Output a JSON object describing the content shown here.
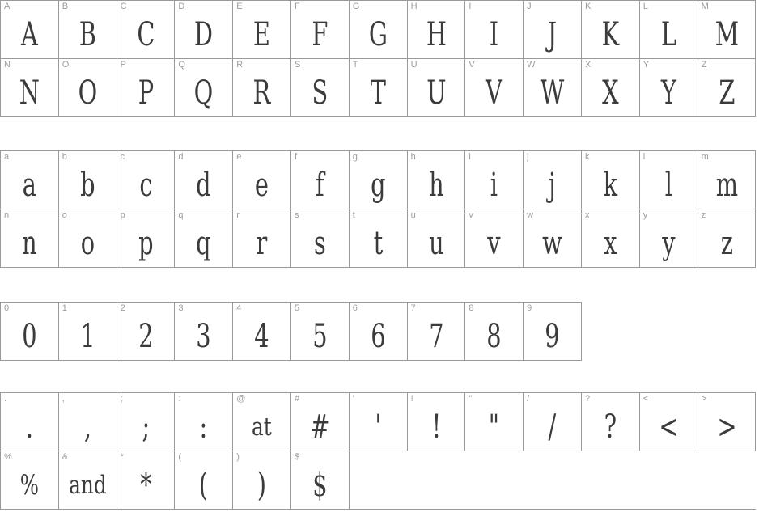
{
  "document": {
    "kind": "font-specimen-character-map",
    "background_color": "#ffffff",
    "grid_border_color": "#9a9a9a",
    "label_color": "#9c9c9c",
    "glyph_color": "#3b3b3b"
  },
  "sections": [
    {
      "name": "uppercase",
      "rows": [
        [
          {
            "label": "A",
            "glyph": "A"
          },
          {
            "label": "B",
            "glyph": "B"
          },
          {
            "label": "C",
            "glyph": "C"
          },
          {
            "label": "D",
            "glyph": "D"
          },
          {
            "label": "E",
            "glyph": "E"
          },
          {
            "label": "F",
            "glyph": "F"
          },
          {
            "label": "G",
            "glyph": "G"
          },
          {
            "label": "H",
            "glyph": "H"
          },
          {
            "label": "I",
            "glyph": "I"
          },
          {
            "label": "J",
            "glyph": "J"
          },
          {
            "label": "K",
            "glyph": "K"
          },
          {
            "label": "L",
            "glyph": "L"
          },
          {
            "label": "M",
            "glyph": "M"
          }
        ],
        [
          {
            "label": "N",
            "glyph": "N"
          },
          {
            "label": "O",
            "glyph": "O"
          },
          {
            "label": "P",
            "glyph": "P"
          },
          {
            "label": "Q",
            "glyph": "Q"
          },
          {
            "label": "R",
            "glyph": "R"
          },
          {
            "label": "S",
            "glyph": "S"
          },
          {
            "label": "T",
            "glyph": "T"
          },
          {
            "label": "U",
            "glyph": "U"
          },
          {
            "label": "V",
            "glyph": "V"
          },
          {
            "label": "W",
            "glyph": "W"
          },
          {
            "label": "X",
            "glyph": "X"
          },
          {
            "label": "Y",
            "glyph": "Y"
          },
          {
            "label": "Z",
            "glyph": "Z"
          }
        ]
      ]
    },
    {
      "name": "lowercase",
      "rows": [
        [
          {
            "label": "a",
            "glyph": "a"
          },
          {
            "label": "b",
            "glyph": "b"
          },
          {
            "label": "c",
            "glyph": "c"
          },
          {
            "label": "d",
            "glyph": "d"
          },
          {
            "label": "e",
            "glyph": "e"
          },
          {
            "label": "f",
            "glyph": "f"
          },
          {
            "label": "g",
            "glyph": "g"
          },
          {
            "label": "h",
            "glyph": "h"
          },
          {
            "label": "i",
            "glyph": "i"
          },
          {
            "label": "j",
            "glyph": "j"
          },
          {
            "label": "k",
            "glyph": "k"
          },
          {
            "label": "l",
            "glyph": "l"
          },
          {
            "label": "m",
            "glyph": "m"
          }
        ],
        [
          {
            "label": "n",
            "glyph": "n"
          },
          {
            "label": "o",
            "glyph": "o"
          },
          {
            "label": "p",
            "glyph": "p"
          },
          {
            "label": "q",
            "glyph": "q"
          },
          {
            "label": "r",
            "glyph": "r"
          },
          {
            "label": "s",
            "glyph": "s"
          },
          {
            "label": "t",
            "glyph": "t"
          },
          {
            "label": "u",
            "glyph": "u"
          },
          {
            "label": "v",
            "glyph": "v"
          },
          {
            "label": "w",
            "glyph": "w"
          },
          {
            "label": "x",
            "glyph": "x"
          },
          {
            "label": "y",
            "glyph": "y"
          },
          {
            "label": "z",
            "glyph": "z"
          }
        ]
      ]
    },
    {
      "name": "digits",
      "rows": [
        [
          {
            "label": "0",
            "glyph": "0"
          },
          {
            "label": "1",
            "glyph": "1"
          },
          {
            "label": "2",
            "glyph": "2"
          },
          {
            "label": "3",
            "glyph": "3"
          },
          {
            "label": "4",
            "glyph": "4"
          },
          {
            "label": "5",
            "glyph": "5"
          },
          {
            "label": "6",
            "glyph": "6"
          },
          {
            "label": "7",
            "glyph": "7"
          },
          {
            "label": "8",
            "glyph": "8"
          },
          {
            "label": "9",
            "glyph": "9"
          }
        ]
      ]
    },
    {
      "name": "punctuation",
      "rows": [
        [
          {
            "label": ".",
            "glyph": "."
          },
          {
            "label": ",",
            "glyph": ","
          },
          {
            "label": ";",
            "glyph": ";"
          },
          {
            "label": ":",
            "glyph": ":"
          },
          {
            "label": "@",
            "glyph": "at",
            "style": "word"
          },
          {
            "label": "#",
            "glyph": "#"
          },
          {
            "label": "'",
            "glyph": "'"
          },
          {
            "label": "!",
            "glyph": "!"
          },
          {
            "label": "\"",
            "glyph": "\""
          },
          {
            "label": "/",
            "glyph": "/"
          },
          {
            "label": "?",
            "glyph": "?"
          },
          {
            "label": "<",
            "glyph": "<"
          },
          {
            "label": ">",
            "glyph": ">"
          }
        ],
        [
          {
            "label": "%",
            "glyph": "%",
            "style": "small"
          },
          {
            "label": "&",
            "glyph": "and",
            "style": "word"
          },
          {
            "label": "*",
            "glyph": "*"
          },
          {
            "label": "(",
            "glyph": "("
          },
          {
            "label": ")",
            "glyph": ")"
          },
          {
            "label": "$",
            "glyph": "$"
          }
        ]
      ]
    }
  ]
}
